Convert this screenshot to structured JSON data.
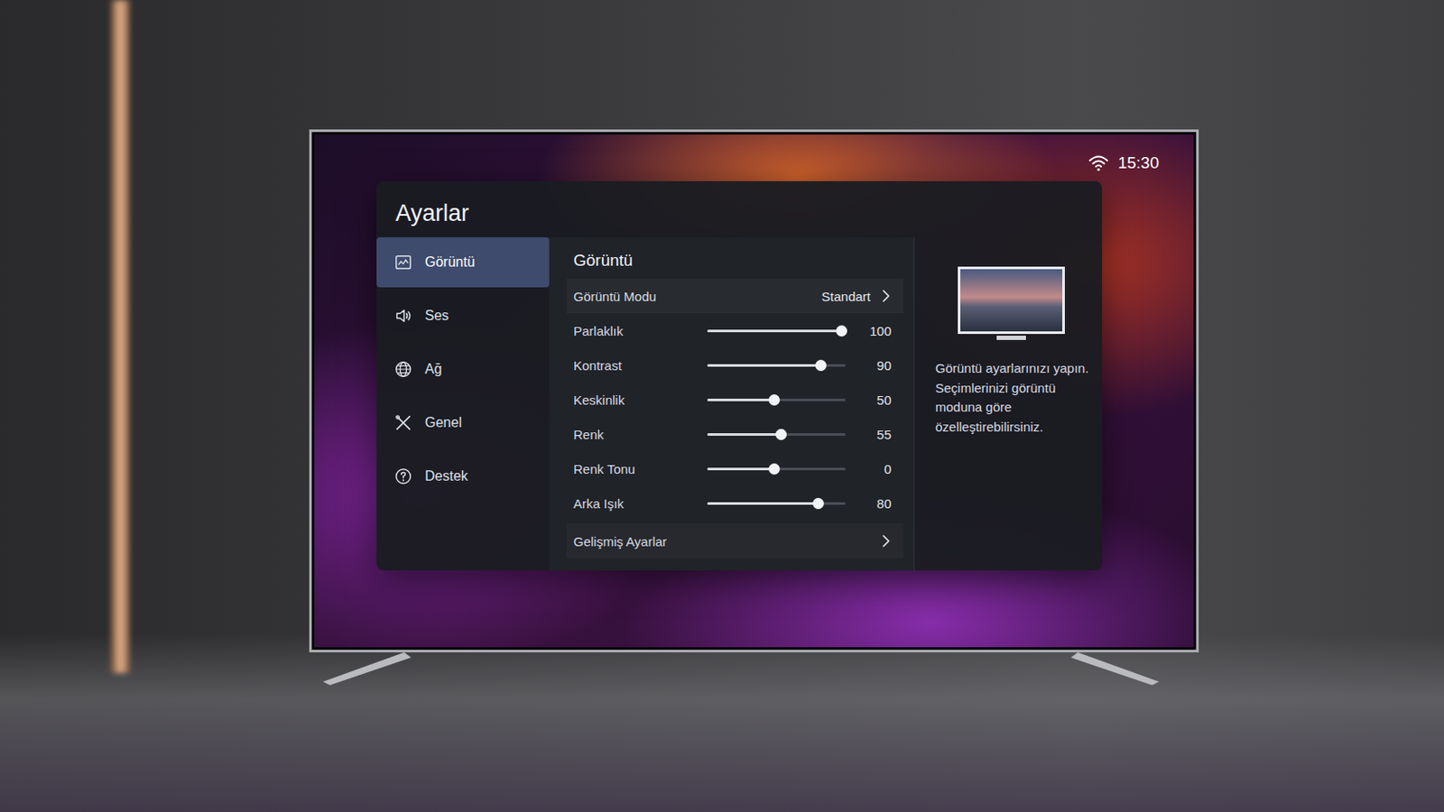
{
  "status_bar": {
    "time": "15:30"
  },
  "panel": {
    "title": "Ayarlar"
  },
  "sidebar": {
    "items": [
      {
        "label": "Görüntü",
        "selected": true
      },
      {
        "label": "Ses",
        "selected": false
      },
      {
        "label": "Ağ",
        "selected": false
      },
      {
        "label": "Genel",
        "selected": false
      },
      {
        "label": "Destek",
        "selected": false
      }
    ]
  },
  "section": {
    "title": "Görüntü",
    "rows": [
      {
        "kind": "select",
        "label": "Görüntü Modu",
        "value": "Standart"
      },
      {
        "kind": "slider",
        "label": "Parlaklık",
        "value": "100",
        "level": 0.97
      },
      {
        "kind": "slider",
        "label": "Kontrast",
        "value": "90",
        "level": 0.82
      },
      {
        "kind": "slider",
        "label": "Keskinlik",
        "value": "50",
        "level": 0.48
      },
      {
        "kind": "slider",
        "label": "Renk",
        "value": "55",
        "level": 0.53
      },
      {
        "kind": "slider",
        "label": "Renk Tonu",
        "value": "0",
        "level": 0.48
      },
      {
        "kind": "slider",
        "label": "Arka Işık",
        "value": "80",
        "level": 0.8
      },
      {
        "kind": "link",
        "label": "Gelişmiş Ayarlar",
        "value": ""
      }
    ]
  },
  "info": {
    "lines": [
      "Görüntü ayarlarınızı yapın.",
      "Seçimlerinizi görüntü moduna göre özelleştirebilirsiniz."
    ]
  }
}
